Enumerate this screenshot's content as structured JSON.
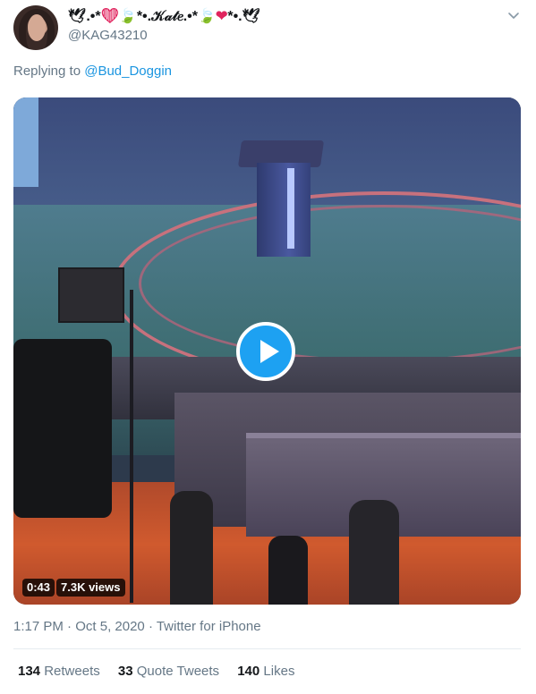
{
  "author": {
    "display_name_prefix": "🕊.•*",
    "display_name_heart": "❤",
    "display_name_leaf": "🍃",
    "display_name_mid": "*•.𝒦𝒶𝓉𝑒.•*",
    "display_name_leaf2": "🍃",
    "display_name_heart2": "❤",
    "display_name_suffix": "*•.🕊",
    "handle": "@KAG43210",
    "avatar_icon": "avatar-photo"
  },
  "reply": {
    "prefix": "Replying to",
    "mention": "@Bud_Doggin"
  },
  "media": {
    "play_icon": "play-icon",
    "duration": "0:43",
    "views": "7.3K views"
  },
  "meta": {
    "time": "1:17 PM",
    "separator1": " · ",
    "date": "Oct 5, 2020",
    "separator2": " · ",
    "source": "Twitter for iPhone"
  },
  "stats": {
    "retweets_count": "134",
    "retweets_label": "Retweets",
    "quote_count": "33",
    "quote_label": "Quote Tweets",
    "likes_count": "140",
    "likes_label": "Likes"
  },
  "colors": {
    "link": "#1b95e0",
    "secondary_text": "#657786",
    "play_button": "#1da1f2"
  }
}
